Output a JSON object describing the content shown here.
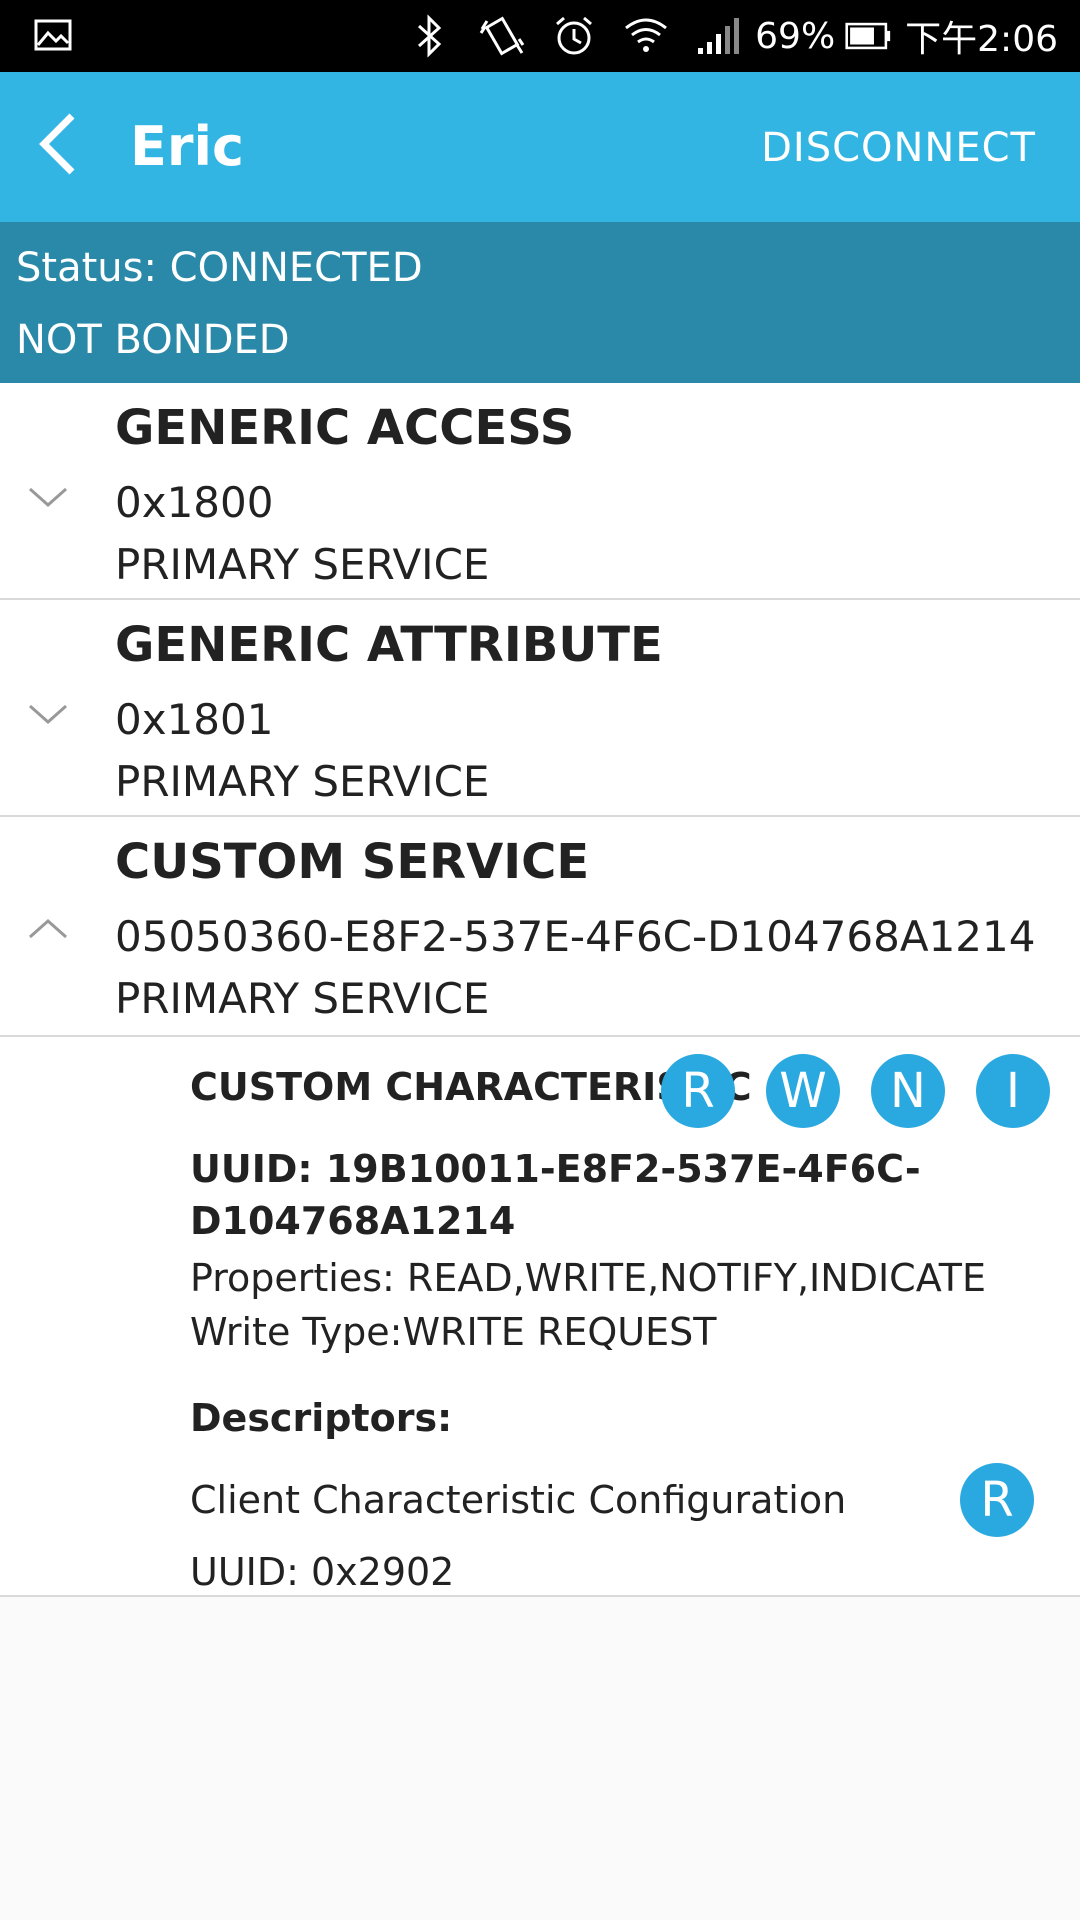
{
  "status_bar": {
    "battery_percent": "69%",
    "time": "下午2:06",
    "icons": [
      "gallery-icon",
      "bluetooth-icon",
      "vibrate-icon",
      "alarm-icon",
      "wifi-icon",
      "signal-icon",
      "battery-icon"
    ]
  },
  "app_bar": {
    "title": "Eric",
    "action": "DISCONNECT",
    "color": "#33b5e3"
  },
  "connection": {
    "status": "Status: CONNECTED",
    "bond": "NOT BONDED",
    "color": "#2a89a8"
  },
  "services": [
    {
      "name": "GENERIC ACCESS",
      "uuid": "0x1800",
      "type": "PRIMARY SERVICE",
      "expanded": false
    },
    {
      "name": "GENERIC ATTRIBUTE",
      "uuid": "0x1801",
      "type": "PRIMARY SERVICE",
      "expanded": false
    },
    {
      "name": "CUSTOM SERVICE",
      "uuid": "05050360-E8F2-537E-4F6C-D104768A1214",
      "type": "PRIMARY SERVICE",
      "expanded": true
    }
  ],
  "characteristic": {
    "name": "CUSTOM CHARACTERISTIC",
    "uuid": "UUID: 19B10011-E8F2-537E-4F6C-D104768A1214",
    "properties": "Properties: READ,WRITE,NOTIFY,INDICATE",
    "write_type": "Write Type:WRITE REQUEST",
    "operations": [
      "R",
      "W",
      "N",
      "I"
    ],
    "accent": "#2aa9e0",
    "descriptors_heading": "Descriptors:",
    "descriptor": {
      "name": "Client Characteristic Configuration",
      "uuid": "UUID: 0x2902",
      "operation": "R"
    }
  }
}
